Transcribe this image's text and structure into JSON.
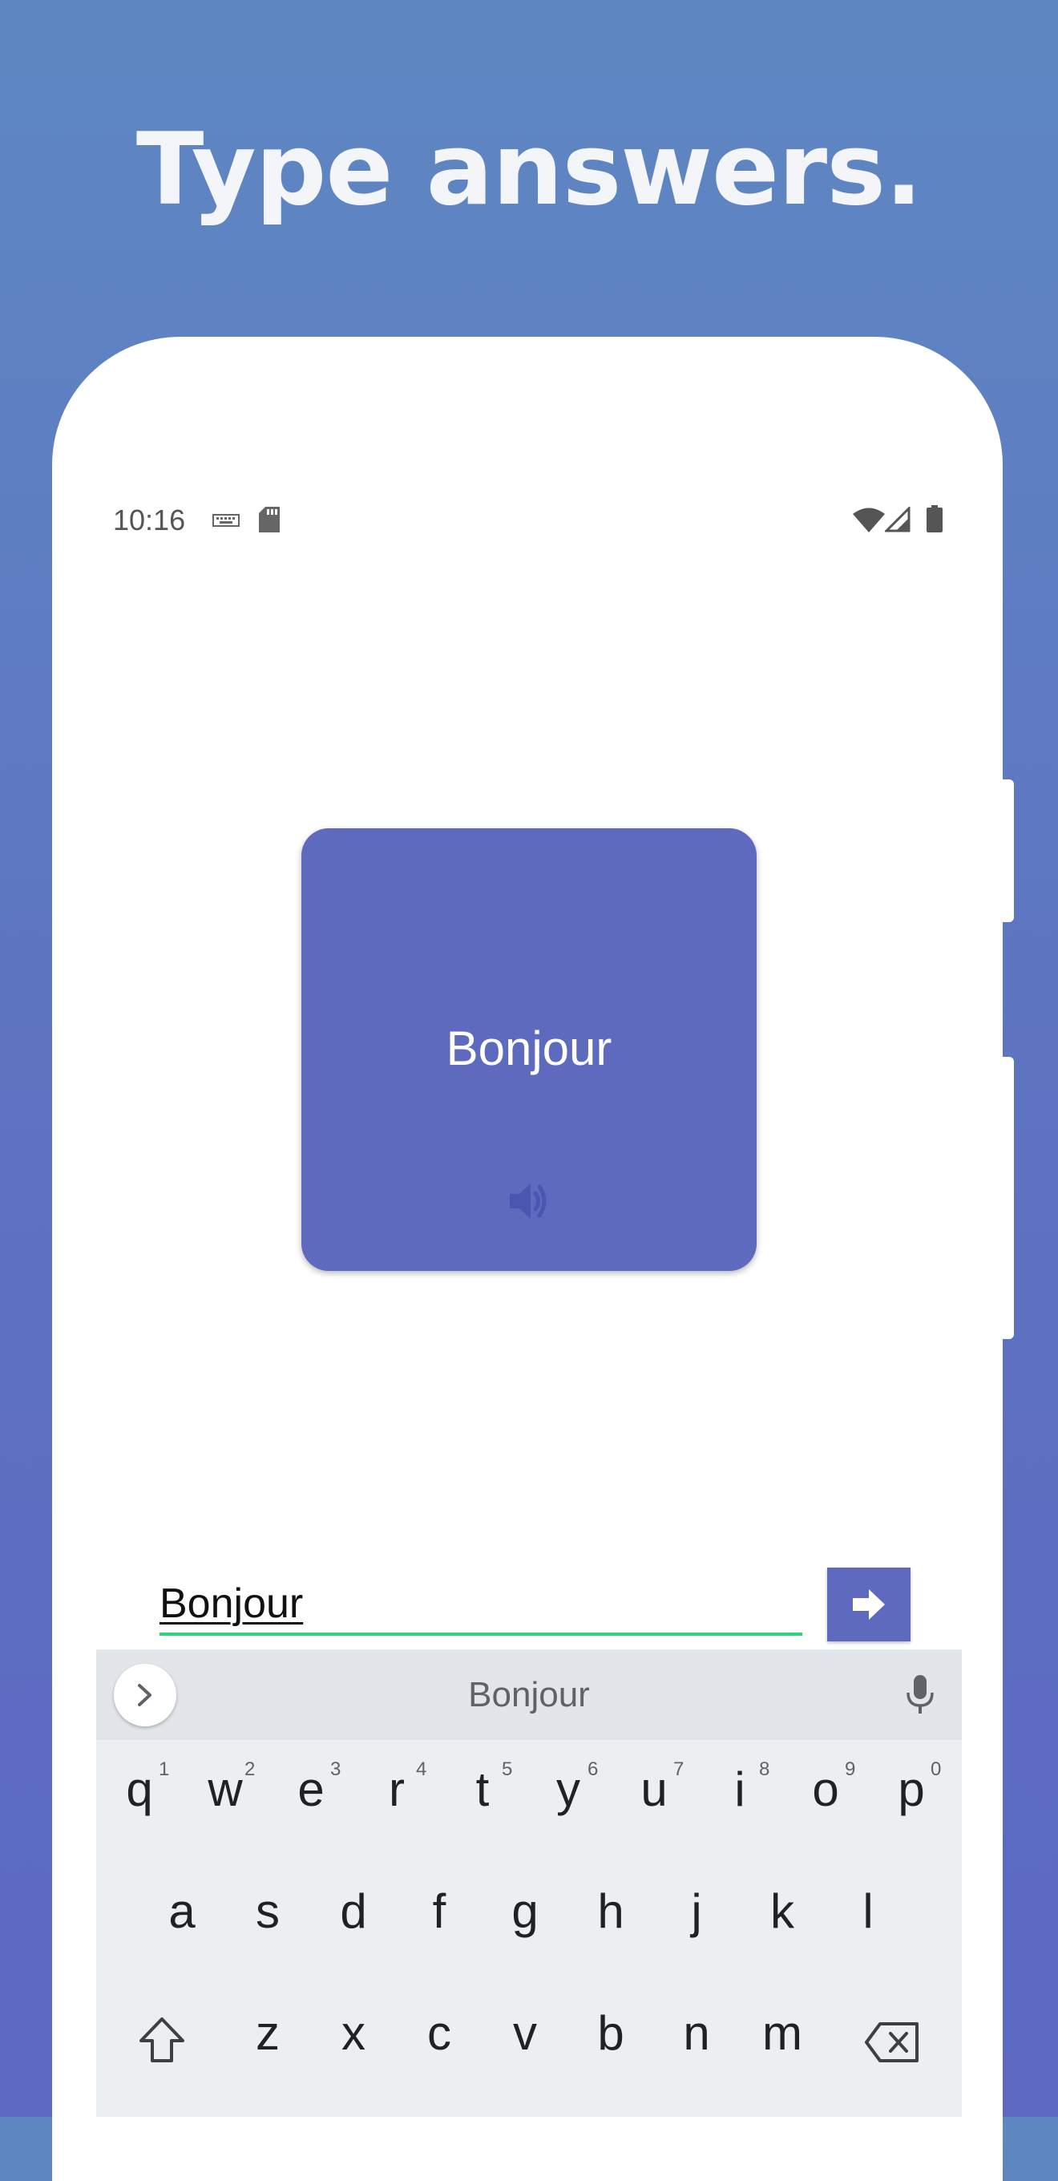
{
  "headline": "Type answers.",
  "status_bar": {
    "time": "10:16",
    "left_icons": [
      "keyboard-icon",
      "sd-card-icon"
    ],
    "right_icons": [
      "wifi-icon",
      "cell-signal-icon",
      "battery-icon"
    ]
  },
  "flashcard": {
    "word": "Bonjour",
    "audio_icon": "speaker-icon",
    "color": "#5e6abe"
  },
  "answer": {
    "value": "Bonjour",
    "underline_color": "#2fd27a",
    "submit_icon": "arrow-right-icon"
  },
  "keyboard": {
    "suggestion": "Bonjour",
    "toolbar_icons": [
      "chevron-right-icon",
      "microphone-icon"
    ],
    "row1": [
      "q",
      "w",
      "e",
      "r",
      "t",
      "y",
      "u",
      "i",
      "o",
      "p"
    ],
    "row1_hints": [
      "1",
      "2",
      "3",
      "4",
      "5",
      "6",
      "7",
      "8",
      "9",
      "0"
    ],
    "row2": [
      "a",
      "s",
      "d",
      "f",
      "g",
      "h",
      "j",
      "k",
      "l"
    ],
    "row3": [
      "z",
      "x",
      "c",
      "v",
      "b",
      "n",
      "m"
    ],
    "row3_icons": [
      "shift-icon",
      "backspace-icon"
    ]
  },
  "colors": {
    "background_top": "#5e88c2",
    "background_bottom": "#5c68c2",
    "accent": "#5e6abe"
  }
}
